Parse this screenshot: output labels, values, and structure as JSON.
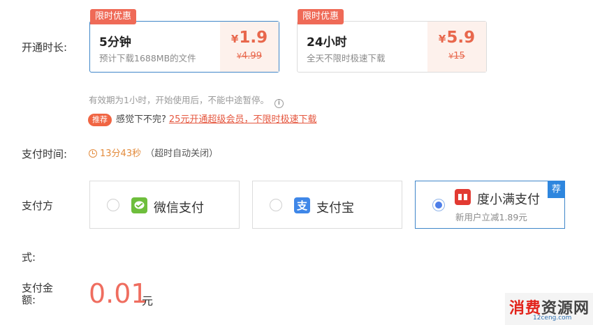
{
  "labels": {
    "duration": "开通时长:",
    "pay_time": "支付时间:",
    "pay_method_1": "支付方",
    "pay_method_2": "式:",
    "amount_1": "支付金",
    "amount_2": "额:"
  },
  "plans": [
    {
      "tag": "限时优惠",
      "name": "5分钟",
      "desc": "预计下载1688MB的文件",
      "currency": "¥",
      "price": "1.9",
      "original": "4.99",
      "selected": true
    },
    {
      "tag": "限时优惠",
      "name": "24小时",
      "desc": "全天不限时极速下载",
      "currency": "¥",
      "price": "5.9",
      "original": "15",
      "selected": false
    }
  ],
  "note": "有效期为1小时，开始使用后，不能中途暂停。",
  "info_icon": "i",
  "promo": {
    "badge": "推荐",
    "text": "感觉下不完?",
    "link": "25元开通超级会员，不限时极速下载"
  },
  "timer": {
    "time": "13分43秒",
    "hint": "（超时自动关闭）"
  },
  "payments": [
    {
      "label": "微信支付",
      "icon": "wechat-pay-icon",
      "color": "#6ebe3c",
      "selected": false
    },
    {
      "label": "支付宝",
      "icon": "alipay-icon",
      "color": "#3f87e8",
      "selected": false
    },
    {
      "label": "度小满支付",
      "sub": "新用户立减1.89元",
      "badge": "荐",
      "icon": "duxiaoman-icon",
      "color": "#e23a32",
      "selected": true
    }
  ],
  "amount": {
    "value": "0.01",
    "unit": "元"
  },
  "watermark": {
    "red": "消费",
    "dark": "资源网",
    "sub": "12ceng.com"
  }
}
